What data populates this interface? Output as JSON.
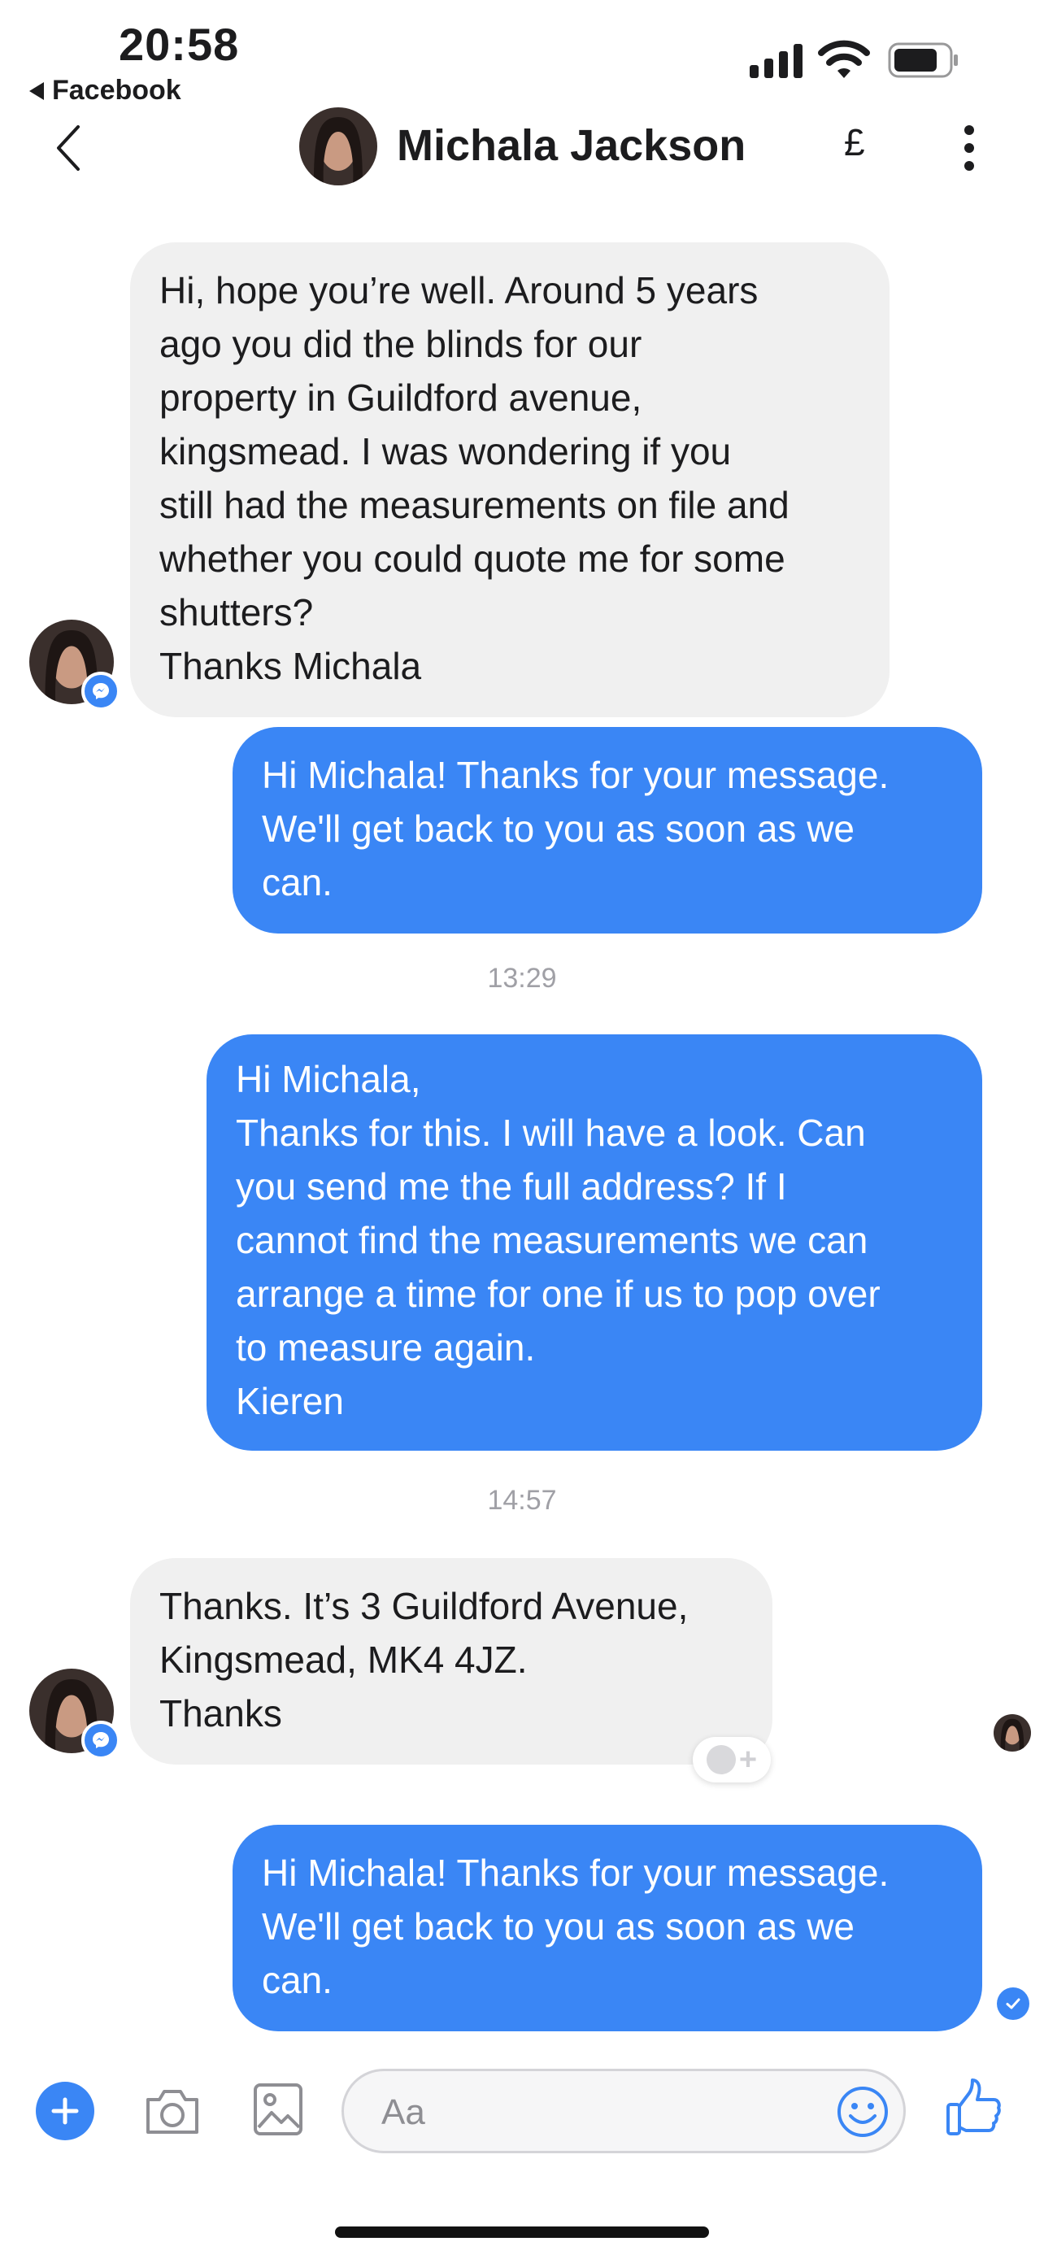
{
  "status_bar": {
    "time": "20:58",
    "back_app": "Facebook"
  },
  "header": {
    "contact_name": "Michala Jackson",
    "currency_symbol": "£"
  },
  "messages": [
    {
      "direction": "incoming",
      "text": "Hi, hope you’re well. Around 5 years\nago you did the blinds for our\nproperty in Guildford avenue,\nkingsmead. I was wondering if you\nstill had the measurements on file and\nwhether you could quote me for some\nshutters?\nThanks Michala"
    },
    {
      "direction": "outgoing",
      "text": "Hi Michala! Thanks for your message.\nWe'll get back to you as soon as we\ncan."
    },
    {
      "direction": "outgoing",
      "text": "Hi Michala,\nThanks for this. I will have a look. Can\nyou send me the full address? If I\ncannot find the measurements we can\narrange a time for one if us to pop over\nto measure again.\nKieren"
    },
    {
      "direction": "incoming",
      "text": "Thanks. It’s 3 Guildford Avenue,\nKingsmead, MK4 4JZ.\nThanks"
    },
    {
      "direction": "outgoing",
      "text": "Hi Michala! Thanks for your message.\nWe'll get back to you as soon as we\ncan."
    }
  ],
  "timestamps": [
    "13:29",
    "14:57"
  ],
  "composer": {
    "placeholder": "Aa"
  },
  "icons": {
    "back": "chevron-left-icon",
    "more": "more-vertical-icon",
    "add": "plus-icon",
    "camera": "camera-icon",
    "gallery": "image-icon",
    "emoji": "smiley-icon",
    "like": "thumbs-up-icon"
  },
  "colors": {
    "accent": "#3a86f5",
    "incoming_bubble": "#f0f0f0",
    "timestamp": "#a0a0a6"
  }
}
